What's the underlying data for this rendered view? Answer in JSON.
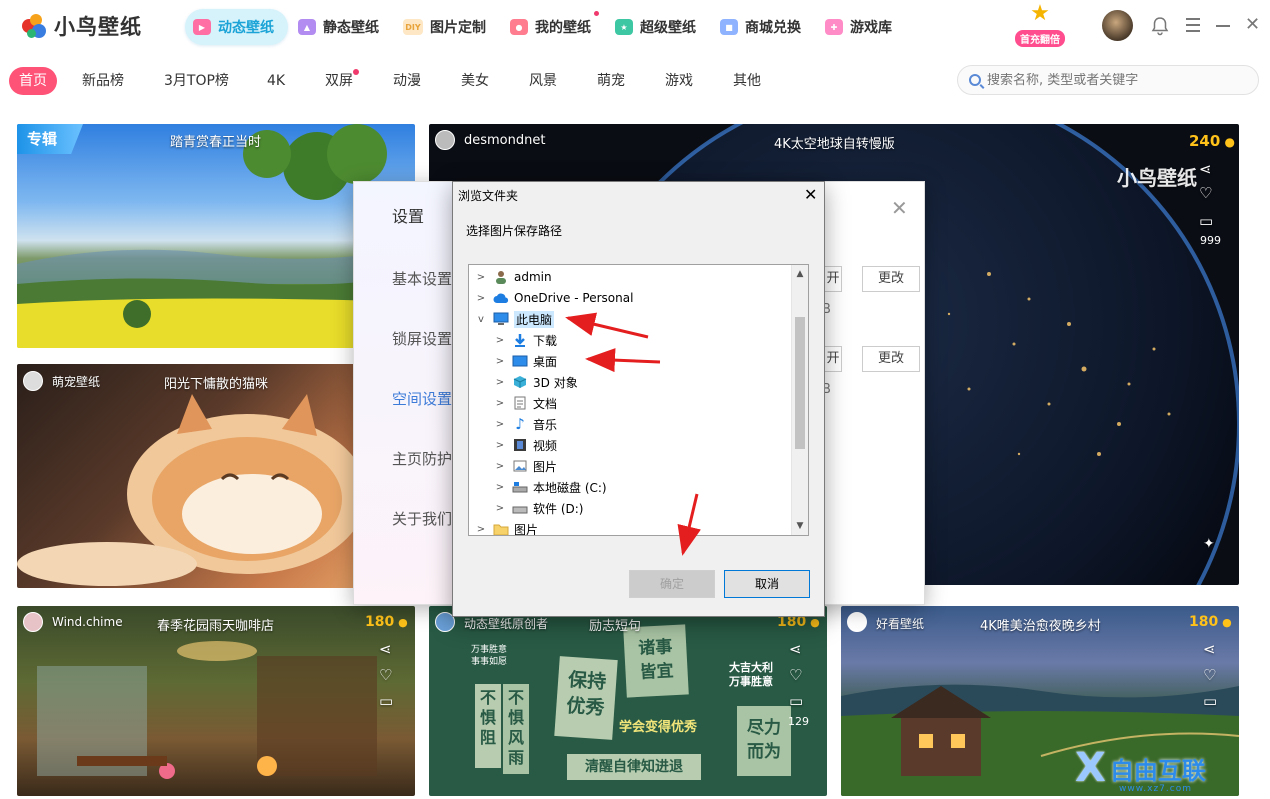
{
  "app": {
    "logo_text": "小鸟壁纸",
    "accent": "#1aa3d6",
    "pink": "#ff5277"
  },
  "nav": {
    "tabs": [
      {
        "label": "动态壁纸",
        "icon": "play-icon",
        "active": true
      },
      {
        "label": "静态壁纸",
        "icon": "image-icon"
      },
      {
        "label": "图片定制",
        "icon": "diy-icon",
        "badge_text": "DIY"
      },
      {
        "label": "我的壁纸",
        "icon": "user-icon",
        "dot": true
      },
      {
        "label": "超级壁纸",
        "icon": "star-icon"
      },
      {
        "label": "商城兑换",
        "icon": "shop-icon"
      },
      {
        "label": "游戏库",
        "icon": "gamepad-icon"
      }
    ],
    "promo_text": "首充翻倍"
  },
  "categories": [
    "首页",
    "新品榜",
    "3月TOP榜",
    "4K",
    "双屏",
    "动漫",
    "美女",
    "风景",
    "萌宠",
    "游戏",
    "其他"
  ],
  "search": {
    "placeholder": "搜索名称, 类型或者关键字"
  },
  "cards": {
    "c1": {
      "tag": "专辑",
      "title": "踏青赏春正当时"
    },
    "c2": {
      "user": "desmondnet",
      "title": "4K太空地球自转慢版",
      "coins": "240",
      "comments": "999",
      "logo": "小鸟壁纸"
    },
    "c3": {
      "user": "萌宠壁纸",
      "title": "阳光下慵散的猫咪"
    },
    "c4": {
      "user": "Wind.chime",
      "title": "春季花园雨天咖啡店",
      "coins": "180"
    },
    "c5": {
      "user": "动态壁纸原创者",
      "title": "励志短句",
      "coins": "180",
      "comments": "129"
    },
    "c6": {
      "user": "好看壁纸",
      "title": "4K唯美治愈夜晚乡村",
      "coins": "180"
    }
  },
  "poster": {
    "n1": "诸事\n皆宜",
    "n2": "保持\n优秀",
    "n3": "不\n惧\n阻",
    "n3b": "不\n惧\n风\n雨",
    "n4": "尽力\n而为",
    "slogan1": "学会变得优秀",
    "slogan2": "清醒自律知进退",
    "corner_left": "万事胜意\n事事如愿",
    "corner_right": "大吉大利\n万事胜意"
  },
  "settings": {
    "title": "设置",
    "items": [
      "基本设置",
      "锁屏设置",
      "空间设置",
      "主页防护",
      "关于我们"
    ],
    "active_index": 2,
    "btn_open": "开",
    "btn_change": "更改",
    "frag": "B"
  },
  "browse": {
    "title": "浏览文件夹",
    "prompt": "选择图片保存路径",
    "tree": [
      {
        "label": "admin",
        "icon": "user-folder-icon",
        "level": 0,
        "expanded": false
      },
      {
        "label": "OneDrive - Personal",
        "icon": "cloud-icon",
        "level": 0,
        "expanded": false
      },
      {
        "label": "此电脑",
        "icon": "computer-icon",
        "level": 0,
        "expanded": true,
        "selected": true
      },
      {
        "label": "下载",
        "icon": "download-icon",
        "level": 1
      },
      {
        "label": "桌面",
        "icon": "desktop-icon",
        "level": 1
      },
      {
        "label": "3D 对象",
        "icon": "cube-icon",
        "level": 1
      },
      {
        "label": "文档",
        "icon": "document-icon",
        "level": 1
      },
      {
        "label": "音乐",
        "icon": "music-icon",
        "level": 1
      },
      {
        "label": "视频",
        "icon": "video-icon",
        "level": 1
      },
      {
        "label": "图片",
        "icon": "picture-icon",
        "level": 1
      },
      {
        "label": "本地磁盘 (C:)",
        "icon": "drive-icon",
        "level": 1
      },
      {
        "label": "软件 (D:)",
        "icon": "drive-icon",
        "level": 1
      },
      {
        "label": "图片",
        "icon": "folder-icon",
        "level": 0
      }
    ],
    "ok": "确定",
    "cancel": "取消"
  },
  "watermark": {
    "text": "自由互联",
    "sub": "www.xz7.com",
    "x": "X"
  }
}
